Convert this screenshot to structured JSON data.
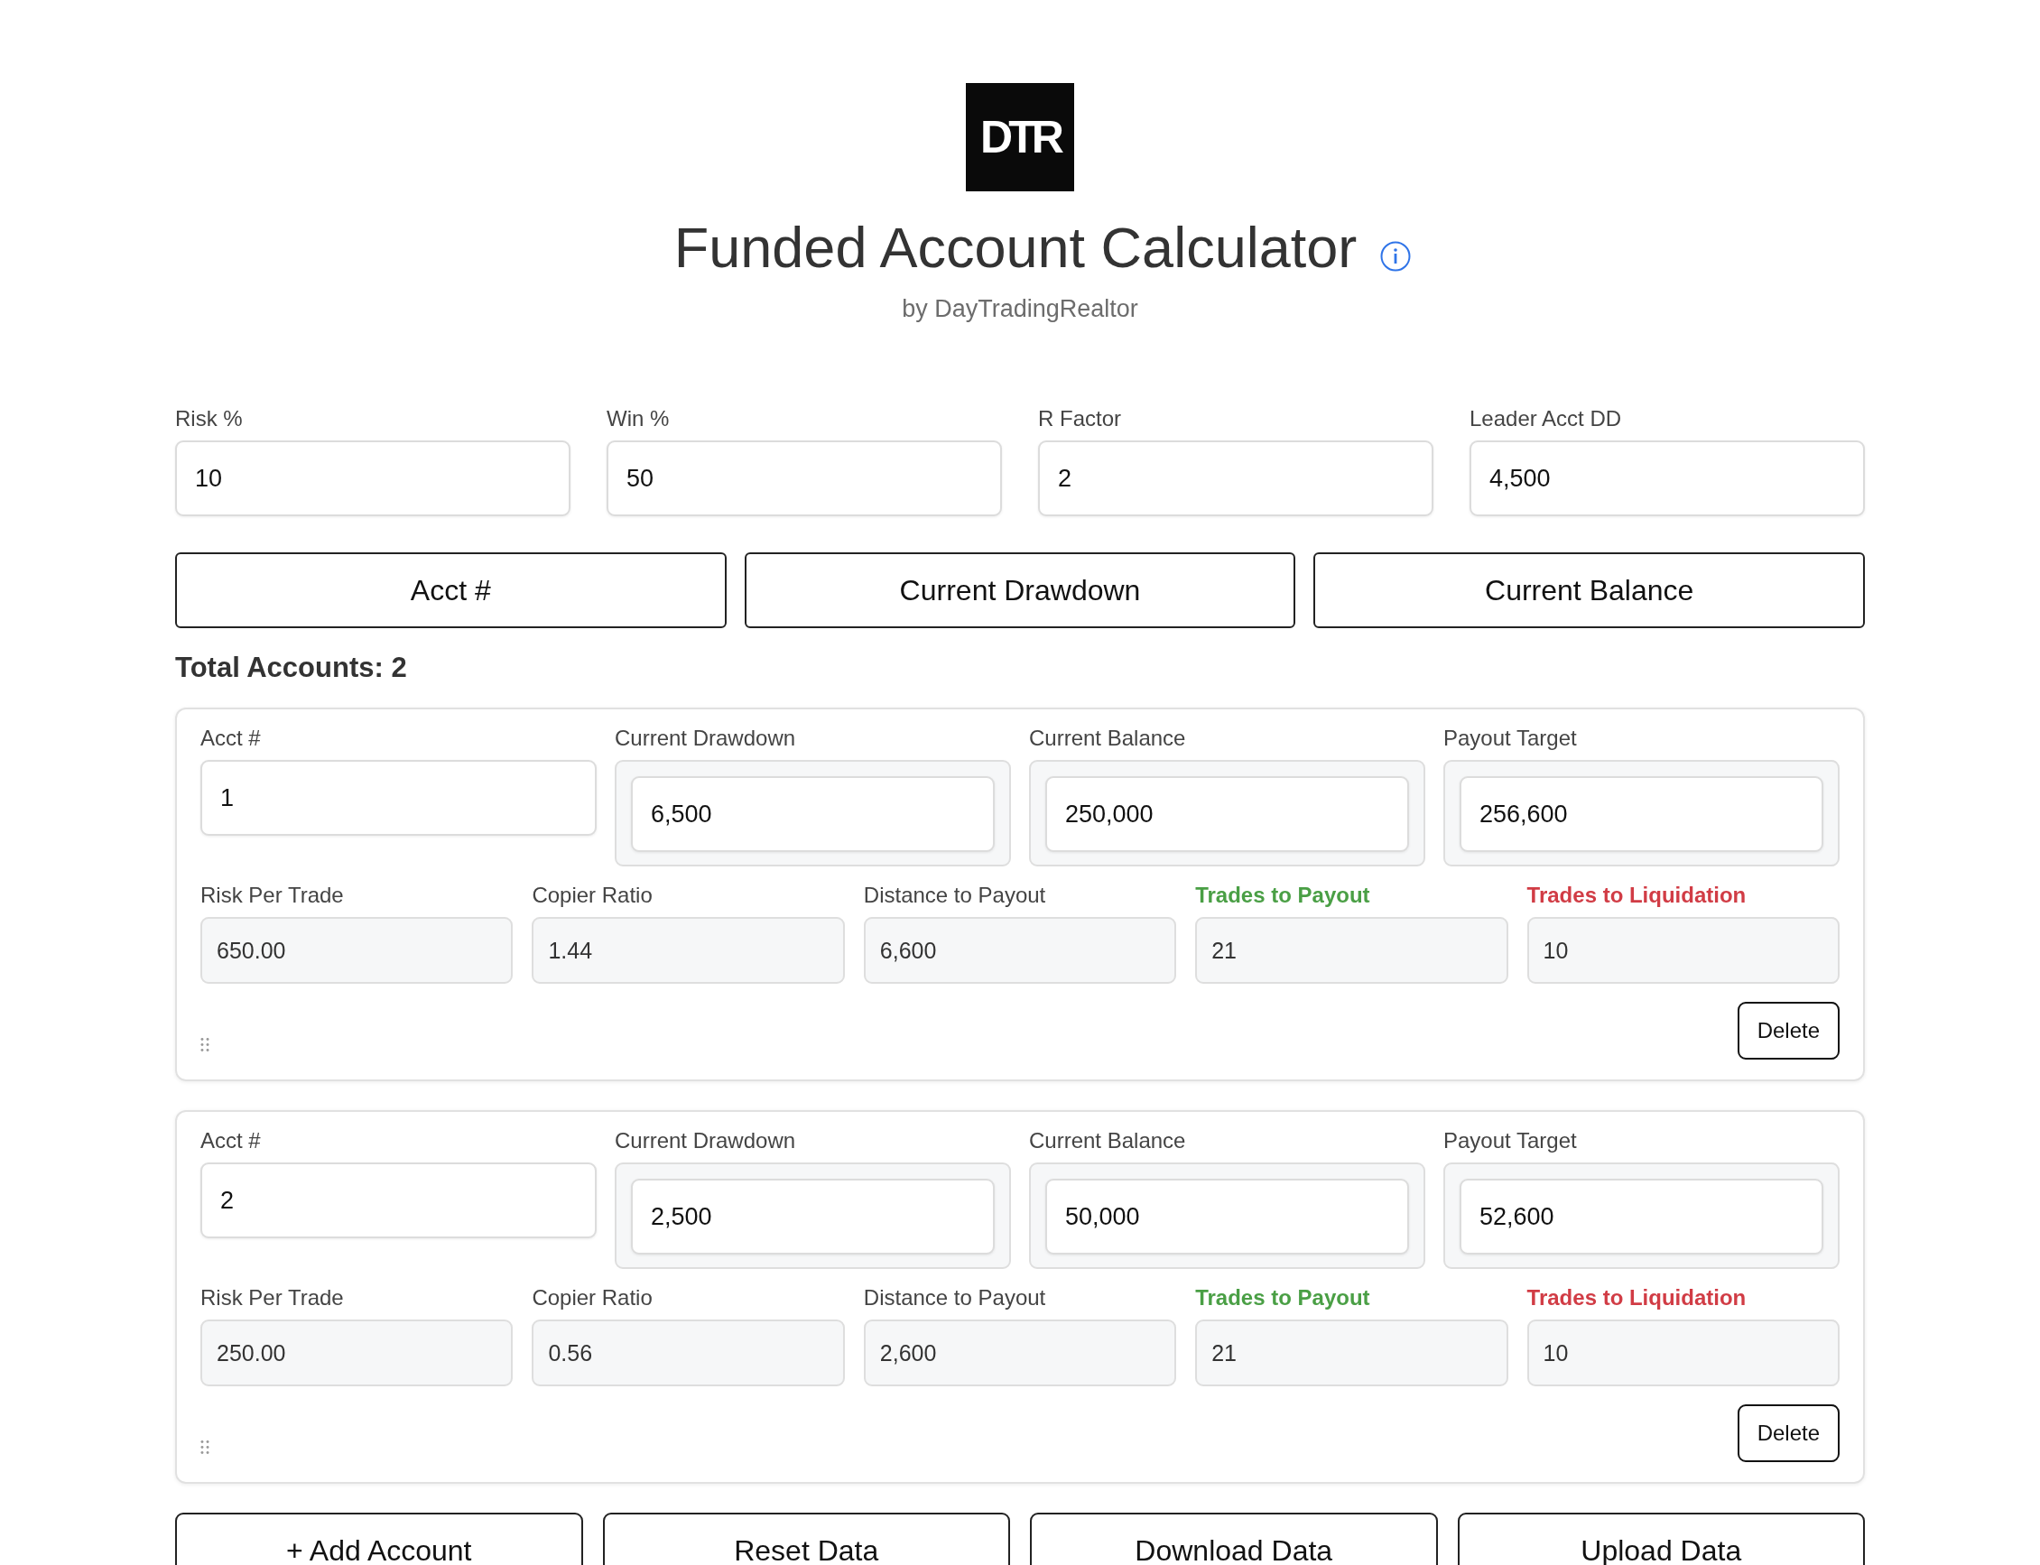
{
  "logo": {
    "text": "DTR"
  },
  "title": "Funded Account Calculator",
  "subtitle": "by DayTradingRealtor",
  "settings": [
    {
      "label": "Risk %",
      "value": "10"
    },
    {
      "label": "Win %",
      "value": "50"
    },
    {
      "label": "R Factor",
      "value": "2"
    },
    {
      "label": "Leader Acct DD",
      "value": "4,500"
    }
  ],
  "sort_buttons": [
    "Acct #",
    "Current Drawdown",
    "Current Balance"
  ],
  "total_accounts": "Total Accounts: 2",
  "accounts": [
    {
      "inputs": [
        {
          "kind": "plain",
          "label": "Acct #",
          "value": "1"
        },
        {
          "kind": "framed",
          "label": "Current Drawdown",
          "value": "6,500"
        },
        {
          "kind": "framed",
          "label": "Current Balance",
          "value": "250,000"
        },
        {
          "kind": "framed",
          "label": "Payout Target",
          "value": "256,600"
        }
      ],
      "outputs": [
        {
          "label": "Risk Per Trade",
          "value": "650.00"
        },
        {
          "label": "Copier Ratio",
          "value": "1.44"
        },
        {
          "label": "Distance to Payout",
          "value": "6,600"
        },
        {
          "label": "Trades to Payout",
          "value": "21",
          "color": "#4a9f45"
        },
        {
          "label": "Trades to Liquidation",
          "value": "10",
          "color": "#d13c45"
        }
      ],
      "delete": "Delete"
    },
    {
      "inputs": [
        {
          "kind": "plain",
          "label": "Acct #",
          "value": "2"
        },
        {
          "kind": "framed",
          "label": "Current Drawdown",
          "value": "2,500"
        },
        {
          "kind": "framed",
          "label": "Current Balance",
          "value": "50,000"
        },
        {
          "kind": "framed",
          "label": "Payout Target",
          "value": "52,600"
        }
      ],
      "outputs": [
        {
          "label": "Risk Per Trade",
          "value": "250.00"
        },
        {
          "label": "Copier Ratio",
          "value": "0.56"
        },
        {
          "label": "Distance to Payout",
          "value": "2,600"
        },
        {
          "label": "Trades to Payout",
          "value": "21",
          "color": "#4a9f45"
        },
        {
          "label": "Trades to Liquidation",
          "value": "10",
          "color": "#d13c45"
        }
      ],
      "delete": "Delete"
    }
  ],
  "actions": [
    "+ Add Account",
    "Reset Data",
    "Download Data",
    "Upload Data"
  ]
}
